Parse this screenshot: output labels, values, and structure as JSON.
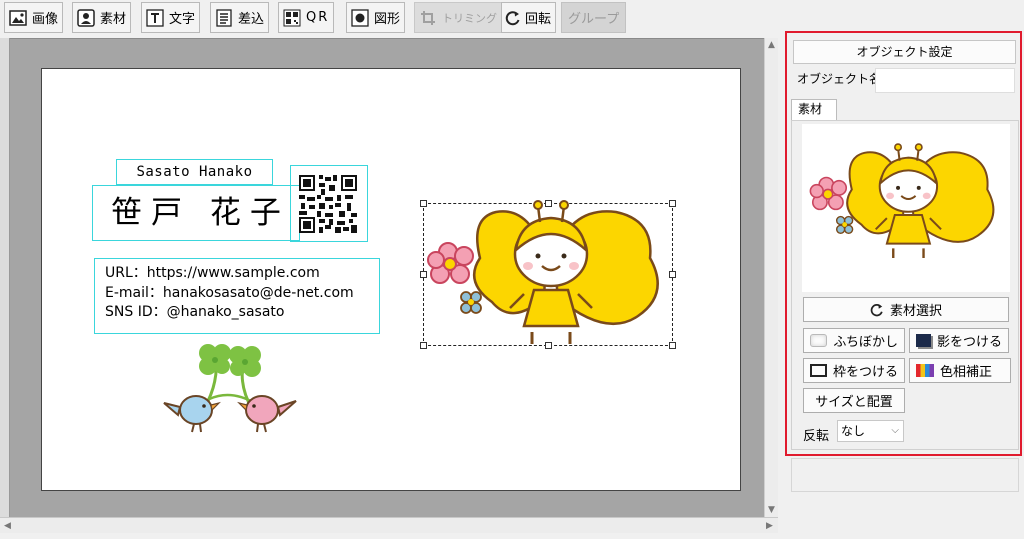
{
  "toolbar": {
    "image": "画像",
    "material": "素材",
    "text": "文字",
    "merge": "差込",
    "qr": "QR",
    "shape": "図形",
    "trimming": "トリミング",
    "rotate": "回転",
    "group": "グループ"
  },
  "card": {
    "name_en": "Sasato Hanako",
    "name_jp": "笹戸 花子",
    "info_lines": [
      "URL：https://www.sample.com",
      "E-mail：hanakosasato@de-net.com",
      "SNS ID：@hanako_sasato"
    ]
  },
  "panel": {
    "title": "オブジェクト設定",
    "object_name_label": "オブジェクト名",
    "object_name_value": "",
    "tab_label": "素材",
    "select_material": "素材選択",
    "blur": "ふちぼかし",
    "shadow": "影をつける",
    "frame": "枠をつける",
    "hue": "色相補正",
    "size_layout": "サイズと配置",
    "flip_label": "反転",
    "flip_value": "なし"
  },
  "colors": {
    "panel_border": "#e01a2d",
    "selection_box": "#3ad6dc",
    "bee_wing": "#fcd600",
    "outline": "#7a4a1a"
  }
}
